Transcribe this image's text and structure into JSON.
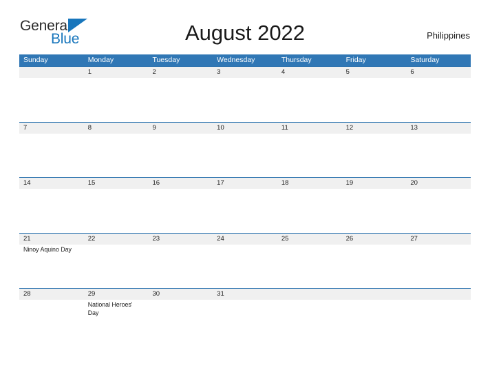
{
  "brand": {
    "name_part1": "General",
    "name_part2": "Blue",
    "flag_icon": "flag-triangle-icon",
    "accent_color": "#1876bc"
  },
  "header": {
    "title": "August 2022",
    "country": "Philippines"
  },
  "theme": {
    "header_blue": "#3077b5",
    "row_line_blue": "#2e74b0",
    "date_band_gray": "#f0f0f0",
    "text_dark": "#1a1a1a",
    "page_background": "#ffffff"
  },
  "calendar": {
    "month": "August",
    "year": "2022",
    "weekday_headers": [
      "Sunday",
      "Monday",
      "Tuesday",
      "Wednesday",
      "Thursday",
      "Friday",
      "Saturday"
    ],
    "weeks": [
      {
        "days": [
          {
            "date": "",
            "event": ""
          },
          {
            "date": "1",
            "event": ""
          },
          {
            "date": "2",
            "event": ""
          },
          {
            "date": "3",
            "event": ""
          },
          {
            "date": "4",
            "event": ""
          },
          {
            "date": "5",
            "event": ""
          },
          {
            "date": "6",
            "event": ""
          }
        ]
      },
      {
        "days": [
          {
            "date": "7",
            "event": ""
          },
          {
            "date": "8",
            "event": ""
          },
          {
            "date": "9",
            "event": ""
          },
          {
            "date": "10",
            "event": ""
          },
          {
            "date": "11",
            "event": ""
          },
          {
            "date": "12",
            "event": ""
          },
          {
            "date": "13",
            "event": ""
          }
        ]
      },
      {
        "days": [
          {
            "date": "14",
            "event": ""
          },
          {
            "date": "15",
            "event": ""
          },
          {
            "date": "16",
            "event": ""
          },
          {
            "date": "17",
            "event": ""
          },
          {
            "date": "18",
            "event": ""
          },
          {
            "date": "19",
            "event": ""
          },
          {
            "date": "20",
            "event": ""
          }
        ]
      },
      {
        "days": [
          {
            "date": "21",
            "event": "Ninoy Aquino Day"
          },
          {
            "date": "22",
            "event": ""
          },
          {
            "date": "23",
            "event": ""
          },
          {
            "date": "24",
            "event": ""
          },
          {
            "date": "25",
            "event": ""
          },
          {
            "date": "26",
            "event": ""
          },
          {
            "date": "27",
            "event": ""
          }
        ]
      },
      {
        "days": [
          {
            "date": "28",
            "event": ""
          },
          {
            "date": "29",
            "event": "National Heroes' Day"
          },
          {
            "date": "30",
            "event": ""
          },
          {
            "date": "31",
            "event": ""
          },
          {
            "date": "",
            "event": ""
          },
          {
            "date": "",
            "event": ""
          },
          {
            "date": "",
            "event": ""
          }
        ]
      }
    ]
  }
}
